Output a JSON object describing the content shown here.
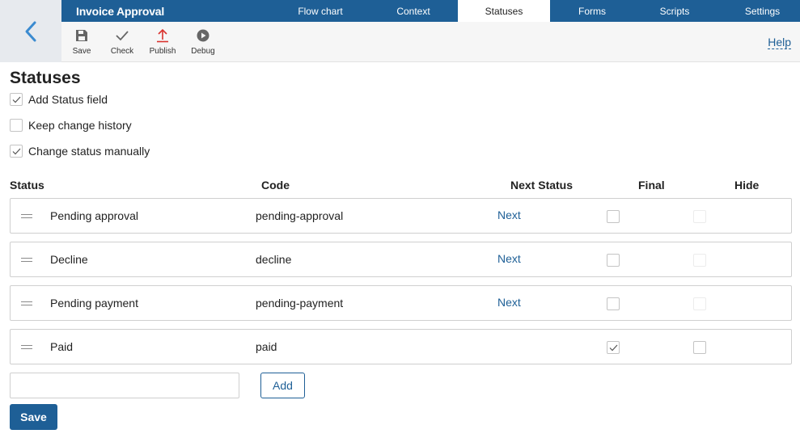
{
  "app": {
    "title": "Invoice Approval"
  },
  "tabs": [
    {
      "label": "Flow chart",
      "active": false
    },
    {
      "label": "Context",
      "active": false
    },
    {
      "label": "Statuses",
      "active": true
    },
    {
      "label": "Forms",
      "active": false
    },
    {
      "label": "Scripts",
      "active": false
    },
    {
      "label": "Settings",
      "active": false
    }
  ],
  "toolbar": {
    "save": {
      "label": "Save",
      "icon": "floppy-disk-icon"
    },
    "check": {
      "label": "Check",
      "icon": "checkmark-icon"
    },
    "publish": {
      "label": "Publish",
      "icon": "upload-arrow-icon"
    },
    "debug": {
      "label": "Debug",
      "icon": "play-circle-icon"
    },
    "help_label": "Help"
  },
  "page": {
    "title": "Statuses"
  },
  "options": [
    {
      "label": "Add Status field",
      "checked": true
    },
    {
      "label": "Keep change history",
      "checked": false
    },
    {
      "label": "Change status manually",
      "checked": true
    }
  ],
  "table": {
    "headers": {
      "status": "Status",
      "code": "Code",
      "next": "Next Status",
      "final": "Final",
      "hide": "Hide"
    },
    "rows": [
      {
        "name": "Pending approval",
        "code": "pending-approval",
        "next": "Next",
        "final": false,
        "hide": false,
        "hide_enabled": false
      },
      {
        "name": "Decline",
        "code": "decline",
        "next": "Next",
        "final": false,
        "hide": false,
        "hide_enabled": false
      },
      {
        "name": "Pending payment",
        "code": "pending-payment",
        "next": "Next",
        "final": false,
        "hide": false,
        "hide_enabled": false
      },
      {
        "name": "Paid",
        "code": "paid",
        "next": "",
        "final": true,
        "hide": false,
        "hide_enabled": true
      }
    ]
  },
  "new_status": {
    "value": "",
    "placeholder": ""
  },
  "buttons": {
    "add": "Add",
    "save": "Save"
  },
  "colors": {
    "brand": "#1e5f96",
    "back_area": "#e7eaee",
    "toolbar_bg": "#f6f6f6",
    "publish_icon": "#d9322e"
  }
}
